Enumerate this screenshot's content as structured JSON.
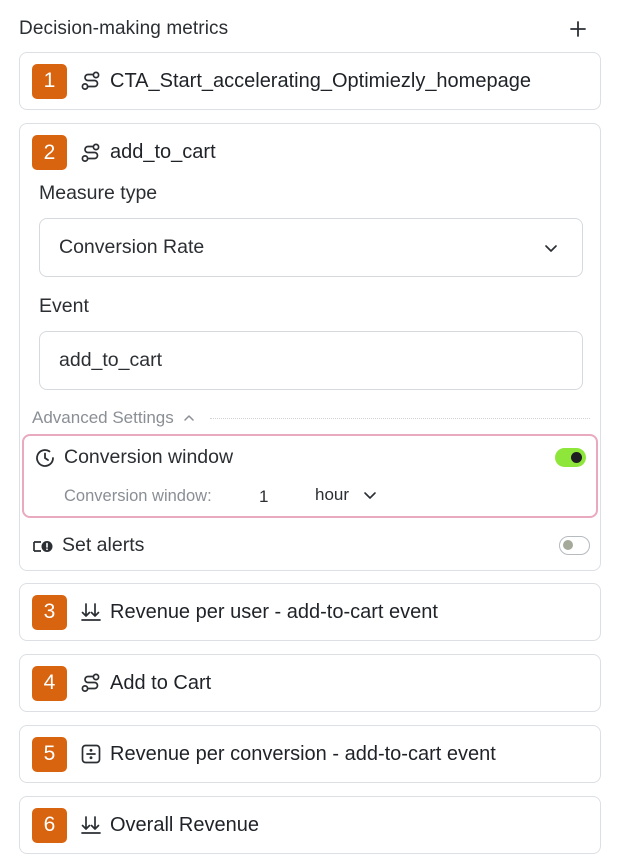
{
  "header": {
    "title": "Decision-making metrics",
    "add_icon": "plus-icon"
  },
  "metrics": [
    {
      "number": "1",
      "icon": "event-path-icon",
      "name": "CTA_Start_accelerating_Optimiezly_homepage"
    },
    {
      "number": "2",
      "icon": "event-path-icon",
      "name": "add_to_cart"
    },
    {
      "number": "3",
      "icon": "sort-descending-icon",
      "name": "Revenue per user - add-to-cart event"
    },
    {
      "number": "4",
      "icon": "event-path-icon",
      "name": "Add to Cart"
    },
    {
      "number": "5",
      "icon": "division-box-icon",
      "name": "Revenue per conversion - add-to-cart event"
    },
    {
      "number": "6",
      "icon": "sort-descending-icon",
      "name": "Overall Revenue"
    }
  ],
  "expanded": {
    "measure_type_label": "Measure type",
    "measure_type_value": "Conversion Rate",
    "event_label": "Event",
    "event_value": "add_to_cart",
    "advanced_settings_label": "Advanced Settings",
    "conversion_window": {
      "title": "Conversion window",
      "enabled": true,
      "sub_label": "Conversion window:",
      "value": "1",
      "unit": "hour"
    },
    "alerts": {
      "label": "Set alerts",
      "enabled": false
    }
  },
  "colors": {
    "badge": "#d9640f",
    "toggle_on": "#8fe63b",
    "highlight_border": "#e9a9bf"
  }
}
